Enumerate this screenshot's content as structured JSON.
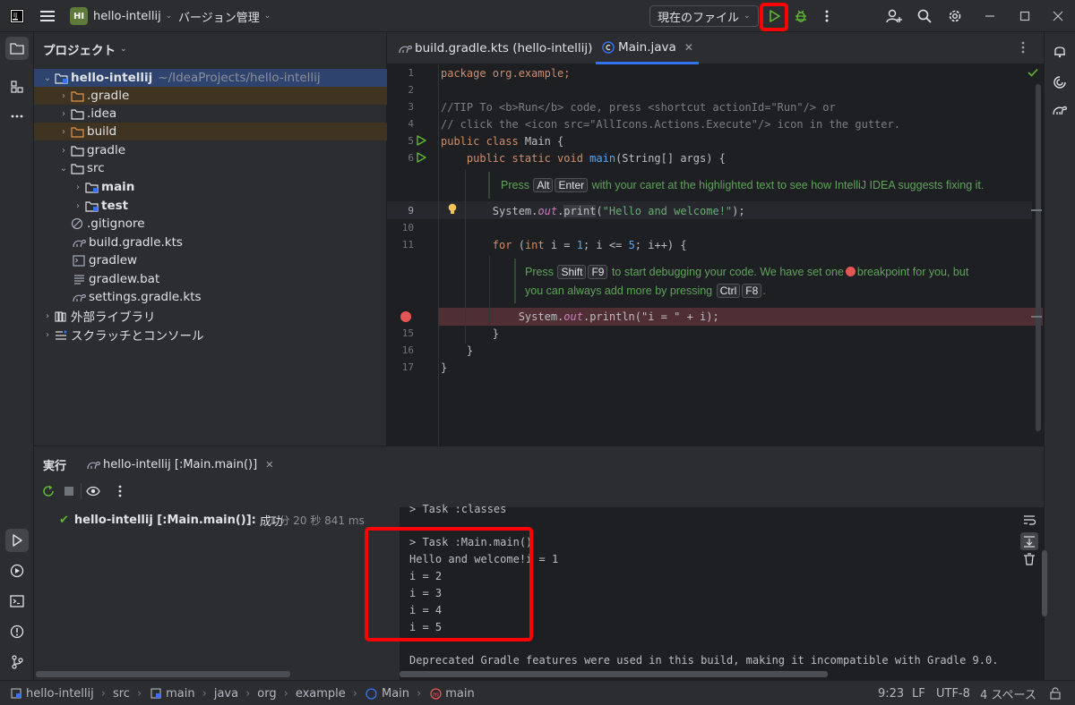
{
  "titlebar": {
    "project_badge": "HI",
    "project_name": "hello-intellij",
    "vcs_label": "バージョン管理",
    "run_config": "現在のファイル"
  },
  "project_panel": {
    "title": "プロジェクト",
    "root": {
      "name": "hello-intellij",
      "path": "~/IdeaProjects/hello-intellij"
    },
    "items": [
      {
        "label": ".gradle"
      },
      {
        "label": ".idea"
      },
      {
        "label": "build"
      },
      {
        "label": "gradle"
      },
      {
        "label": "src"
      },
      {
        "label": "main"
      },
      {
        "label": "test"
      },
      {
        "label": ".gitignore"
      },
      {
        "label": "build.gradle.kts"
      },
      {
        "label": "gradlew"
      },
      {
        "label": "gradlew.bat"
      },
      {
        "label": "settings.gradle.kts"
      },
      {
        "label": "外部ライブラリ"
      },
      {
        "label": "スクラッチとコンソール"
      }
    ]
  },
  "editor": {
    "tabs": [
      {
        "label": "build.gradle.kts (hello-intellij)"
      },
      {
        "label": "Main.java"
      }
    ],
    "line_numbers": [
      "1",
      "2",
      "3",
      "4",
      "5",
      "6",
      "9",
      "10",
      "11",
      "15",
      "16",
      "17"
    ],
    "code": {
      "l1": "package org.example;",
      "l3": "//TIP To <b>Run</b> code, press <shortcut actionId=\"Run\"/> or",
      "l4": "// click the <icon src=\"AllIcons.Actions.Execute\"/> icon in the gutter.",
      "l5a": "public class",
      "l5b": " Main {",
      "l6a": "    public static void",
      "l6b": " main",
      "l6c": "(String[] args) {",
      "l9a": "        System.",
      "l9b": "out",
      "l9c": ".",
      "l9d": "print",
      "l9e": "(",
      "l9f": "\"Hello and welcome!\"",
      "l9g": ");",
      "l11a": "        for",
      "l11b": " (",
      "l11c": "int",
      "l11d": " i = ",
      "l11e": "1",
      "l11f": "; i <= ",
      "l11g": "5",
      "l11h": "; i++) {",
      "l14a": "            System.",
      "l14b": "out",
      "l14c": ".println(\"i = \" + i);",
      "l15": "        }",
      "l16": "    }",
      "l17": "}"
    },
    "hint1": {
      "pre": "Press",
      "k1": "Alt",
      "k2": "Enter",
      "post": "with your caret at the highlighted text to see how IntelliJ IDEA suggests fixing it."
    },
    "hint2": {
      "pre": "Press",
      "k1": "Shift",
      "k2": "F9",
      "mid": "to start debugging your code. We have set one",
      "post": "breakpoint for you, but",
      "line2": "you can always add more by pressing",
      "k3": "Ctrl",
      "k4": "F8",
      "end": "."
    }
  },
  "run_panel": {
    "title": "実行",
    "tab_label": "hello-intellij [:Main.main()]",
    "tree_item": "hello-intellij [:Main.main()]:",
    "tree_status": "成功",
    "duration": "1 分 20 秒 841 ms",
    "console_lines": [
      "> Task :classes",
      "> Task :Main.main()",
      "Hello and welcome!i = 1",
      "i = 2",
      "i = 3",
      "i = 4",
      "i = 5",
      "Deprecated Gradle features were used in this build, making it incompatible with Gradle 9.0."
    ]
  },
  "statusbar": {
    "breadcrumbs": [
      "hello-intellij",
      "src",
      "main",
      "java",
      "org",
      "example",
      "Main",
      "main"
    ],
    "position": "9:23",
    "line_sep": "LF",
    "encoding": "UTF-8",
    "indent": "4 スペース"
  },
  "colors": {
    "accent": "#3574f0",
    "run_green": "#5fb832",
    "highlight_red": "#ff0000",
    "breakpoint": "#e55555"
  }
}
